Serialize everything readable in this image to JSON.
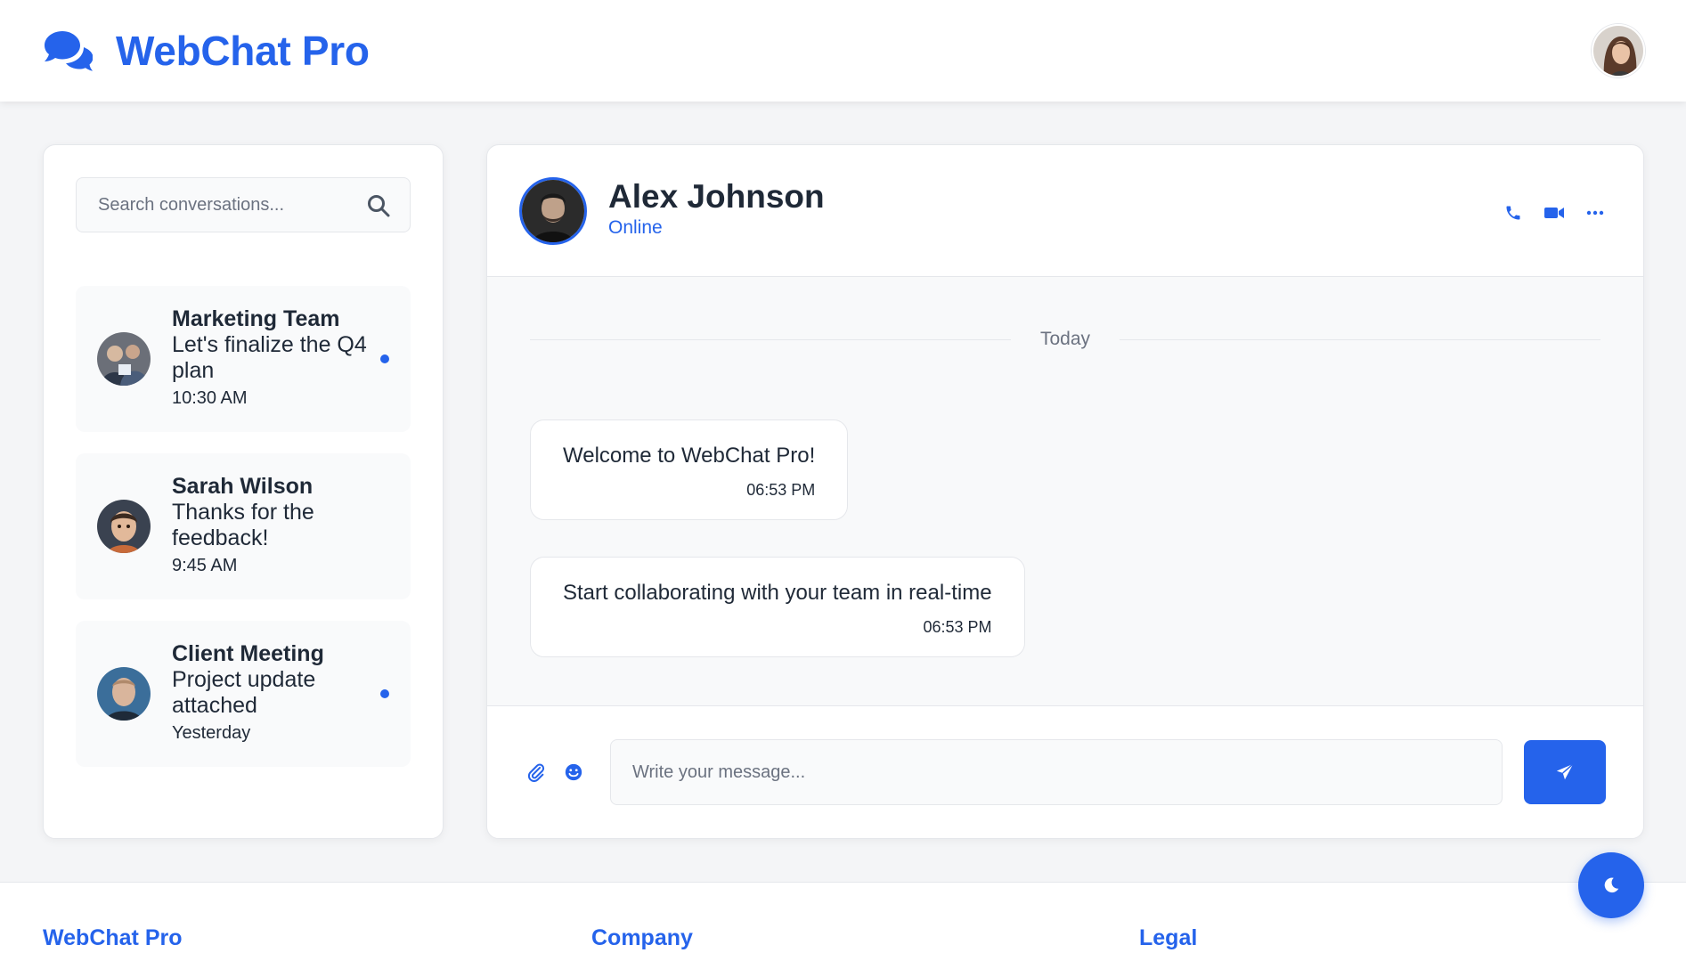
{
  "app": {
    "title": "WebChat Pro",
    "brand_color": "#2563eb"
  },
  "header": {
    "logo_icon": "chat-bubbles-icon",
    "user_avatar": "user-avatar"
  },
  "sidebar": {
    "search": {
      "placeholder": "Search conversations...",
      "icon": "search-icon"
    },
    "conversations": [
      {
        "name": "Marketing Team",
        "preview": "Let's finalize the Q4 plan",
        "time": "10:30 AM",
        "unread": true
      },
      {
        "name": "Sarah Wilson",
        "preview": "Thanks for the feedback!",
        "time": "9:45 AM",
        "unread": false
      },
      {
        "name": "Client Meeting",
        "preview": "Project update attached",
        "time": "Yesterday",
        "unread": true
      }
    ]
  },
  "chat": {
    "contact_name": "Alex Johnson",
    "contact_status": "Online",
    "actions": [
      "phone-icon",
      "video-icon",
      "more-icon"
    ],
    "day_label": "Today",
    "messages": [
      {
        "text": "Welcome to WebChat Pro!",
        "time": "06:53 PM"
      },
      {
        "text": "Start collaborating with your team in real-time",
        "time": "06:53 PM"
      }
    ],
    "composer": {
      "placeholder": "Write your message...",
      "tools": [
        "paperclip-icon",
        "smile-icon"
      ],
      "send_icon": "paper-plane-icon"
    }
  },
  "theme_toggle": {
    "icon": "moon-icon"
  },
  "footer": {
    "headings": [
      "WebChat Pro",
      "Company",
      "Legal"
    ]
  }
}
